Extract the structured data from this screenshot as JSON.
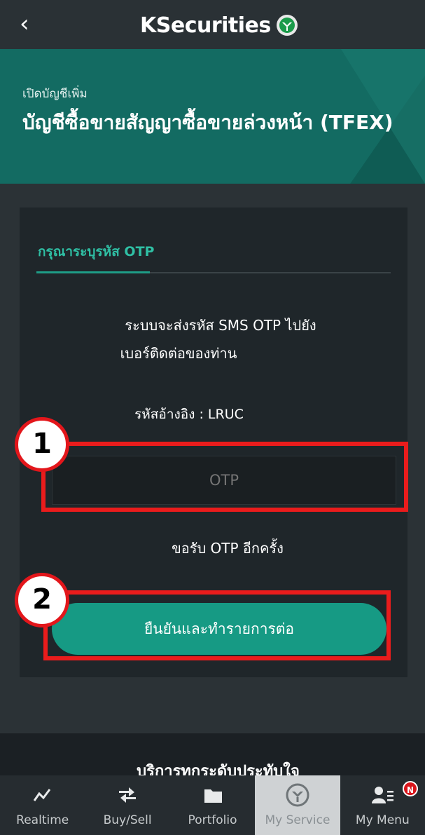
{
  "topbar": {
    "back_icon": "chevron-left-icon",
    "brand": "KSecurities"
  },
  "banner": {
    "subtitle": "เปิดบัญชีเพิ่ม",
    "title": "บัญชีซื้อขายสัญญาซื้อขายล่วงหน้า (TFEX)"
  },
  "card": {
    "heading": "กรุณาระบุรหัส OTP",
    "message_line1": "ระบบจะส่งรหัส SMS OTP ไปยัง",
    "message_line2": "เบอร์ติดต่อของท่าน",
    "reference": "รหัสอ้างอิง : LRUC",
    "otp_placeholder": "OTP",
    "resend": "ขอรับ OTP อีกครั้ง",
    "confirm_button": "ยืนยันและทำรายการต่อ"
  },
  "annotations": {
    "badge1": "1",
    "badge2": "2",
    "color": "#ea1c1c"
  },
  "footer": {
    "text": "บริการทุกระดับประทับใจ"
  },
  "nav": {
    "items": [
      {
        "label": "Realtime",
        "icon": "line-chart-icon"
      },
      {
        "label": "Buy/Sell",
        "icon": "swap-arrows-icon"
      },
      {
        "label": "Portfolio",
        "icon": "folder-icon"
      },
      {
        "label": "My Service",
        "icon": "kbank-leaf-icon",
        "active": true
      },
      {
        "label": "My Menu",
        "icon": "user-menu-icon",
        "badge": "N"
      }
    ]
  },
  "colors": {
    "accent": "#169a84",
    "banner": "#136b62",
    "background": "#2b3236"
  }
}
